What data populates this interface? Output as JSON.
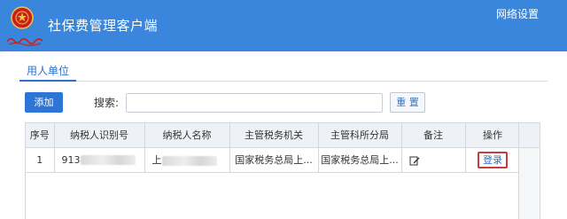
{
  "app": {
    "title": "社保费管理客户端",
    "network_settings": "网络设置"
  },
  "colors": {
    "titlebar": "#3a86dd",
    "accent": "#2f6fc9",
    "login_border": "#d23a3a"
  },
  "tabs": [
    {
      "label": "用人单位",
      "active": true
    }
  ],
  "toolbar": {
    "add_label": "添加",
    "search_label": "搜索:",
    "search_value": "",
    "search_placeholder": "",
    "reset_label": "重 置"
  },
  "table": {
    "columns": [
      "序号",
      "纳税人识别号",
      "纳税人名称",
      "主管税务机关",
      "主管科所分局",
      "备注",
      "操作"
    ],
    "rows": [
      {
        "index": "1",
        "taxpayer_id_prefix": "913",
        "taxpayer_name_prefix": "上",
        "tax_authority": "国家税务总局上...",
        "tax_branch": "国家税务总局上...",
        "remark_icon": "edit-icon",
        "action_label": "登录"
      }
    ]
  }
}
